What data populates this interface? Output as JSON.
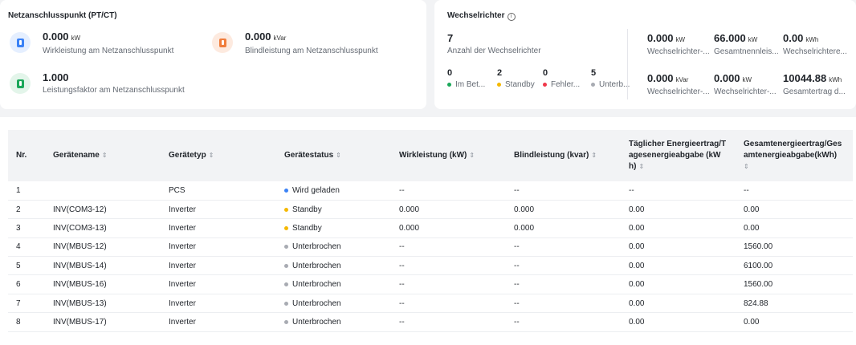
{
  "grid_card": {
    "title": "Netzanschlusspunkt (PT/CT)",
    "active_power": {
      "value": "0.000",
      "unit": "kW",
      "label": "Wirkleistung am Netzanschlusspunkt"
    },
    "reactive_power": {
      "value": "0.000",
      "unit": "kVar",
      "label": "Blindleistung am Netzanschlusspunkt"
    },
    "power_factor": {
      "value": "1.000",
      "label": "Leistungsfaktor am Netzanschlusspunkt"
    }
  },
  "inverter_card": {
    "title": "Wechselrichter",
    "count": "7",
    "count_label": "Anzahl der Wechselrichter",
    "statuses": [
      {
        "num": "0",
        "label": "Im Bet...",
        "color": "#1ba85a"
      },
      {
        "num": "2",
        "label": "Standby",
        "color": "#f5b800"
      },
      {
        "num": "0",
        "label": "Fehler...",
        "color": "#f0384a"
      },
      {
        "num": "5",
        "label": "Unterb...",
        "color": "#a8abb2"
      }
    ],
    "stats": [
      {
        "value": "0.000",
        "unit": "kW",
        "label": "Wechselrichter-..."
      },
      {
        "value": "66.000",
        "unit": "kW",
        "label": "Gesamtnennleis..."
      },
      {
        "value": "0.00",
        "unit": "kWh",
        "label": "Wechselrichtere..."
      },
      {
        "value": "0.000",
        "unit": "kVar",
        "label": "Wechselrichter-..."
      },
      {
        "value": "0.000",
        "unit": "kW",
        "label": "Wechselrichter-..."
      },
      {
        "value": "10044.88",
        "unit": "kWh",
        "label": "Gesamtertrag d..."
      }
    ]
  },
  "table": {
    "headers": [
      "Nr.",
      "Gerätename",
      "Gerätetyp",
      "Gerätestatus",
      "Wirkleistung (kW)",
      "Blindleistung (kvar)",
      "Täglicher Energieertrag/Tagesenergieabgabe (kWh)",
      "Gesamtenergieertrag/Gesamtenergieabgabe(kWh)"
    ],
    "rows": [
      {
        "nr": "1",
        "name": "",
        "type": "PCS",
        "status": "Wird geladen",
        "status_color": "#3b82f6",
        "p": "--",
        "q": "--",
        "daily": "--",
        "total": "--"
      },
      {
        "nr": "2",
        "name": "INV(COM3-12)",
        "type": "Inverter",
        "status": "Standby",
        "status_color": "#f5b800",
        "p": "0.000",
        "q": "0.000",
        "daily": "0.00",
        "total": "0.00"
      },
      {
        "nr": "3",
        "name": "INV(COM3-13)",
        "type": "Inverter",
        "status": "Standby",
        "status_color": "#f5b800",
        "p": "0.000",
        "q": "0.000",
        "daily": "0.00",
        "total": "0.00"
      },
      {
        "nr": "4",
        "name": "INV(MBUS-12)",
        "type": "Inverter",
        "status": "Unterbrochen",
        "status_color": "#a8abb2",
        "p": "--",
        "q": "--",
        "daily": "0.00",
        "total": "1560.00"
      },
      {
        "nr": "5",
        "name": "INV(MBUS-14)",
        "type": "Inverter",
        "status": "Unterbrochen",
        "status_color": "#a8abb2",
        "p": "--",
        "q": "--",
        "daily": "0.00",
        "total": "6100.00"
      },
      {
        "nr": "6",
        "name": "INV(MBUS-16)",
        "type": "Inverter",
        "status": "Unterbrochen",
        "status_color": "#a8abb2",
        "p": "--",
        "q": "--",
        "daily": "0.00",
        "total": "1560.00"
      },
      {
        "nr": "7",
        "name": "INV(MBUS-13)",
        "type": "Inverter",
        "status": "Unterbrochen",
        "status_color": "#a8abb2",
        "p": "--",
        "q": "--",
        "daily": "0.00",
        "total": "824.88"
      },
      {
        "nr": "8",
        "name": "INV(MBUS-17)",
        "type": "Inverter",
        "status": "Unterbrochen",
        "status_color": "#a8abb2",
        "p": "--",
        "q": "--",
        "daily": "0.00",
        "total": "0.00"
      }
    ]
  }
}
